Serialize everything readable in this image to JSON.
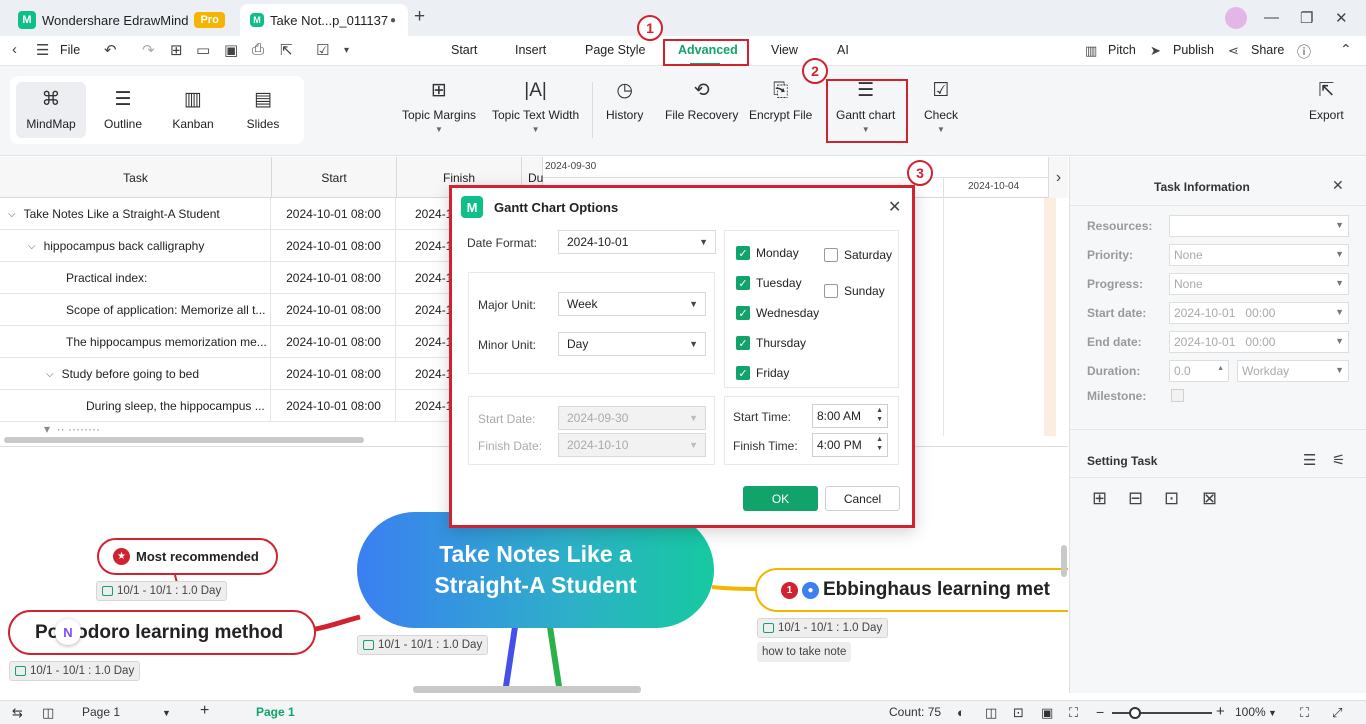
{
  "app": {
    "name": "Wondershare EdrawMind",
    "pro_badge": "Pro",
    "doc_tab": "Take Not...p_011137"
  },
  "menubar": {
    "file": "File",
    "tabs": [
      "Start",
      "Insert",
      "Page Style",
      "Advanced",
      "View",
      "AI"
    ],
    "pitch": "Pitch",
    "publish": "Publish",
    "share": "Share"
  },
  "ribbon": {
    "views": [
      "MindMap",
      "Outline",
      "Kanban",
      "Slides"
    ],
    "tools": [
      "Topic Margins",
      "Topic Text Width",
      "History",
      "File Recovery",
      "Encrypt File",
      "Gantt chart",
      "Check"
    ],
    "export": "Export"
  },
  "annotations": [
    "1",
    "2",
    "3"
  ],
  "gantt": {
    "headers": {
      "task": "Task",
      "start": "Start",
      "finish": "Finish",
      "dur": "Du"
    },
    "timeline_dates": [
      "2024-09-30",
      "2024-10-04"
    ],
    "rows": [
      {
        "task": "Take Notes Like a Straight-A Student",
        "start": "2024-10-01 08:00",
        "finish": "2024-1",
        "level": 0,
        "toggle": true
      },
      {
        "task": "hippocampus back calligraphy",
        "start": "2024-10-01 08:00",
        "finish": "2024-1",
        "level": 1,
        "toggle": true
      },
      {
        "task": "Practical index:",
        "start": "2024-10-01 08:00",
        "finish": "2024-1",
        "level": 2,
        "toggle": false
      },
      {
        "task": "Scope of application: Memorize all t...",
        "start": "2024-10-01 08:00",
        "finish": "2024-1",
        "level": 2,
        "toggle": false
      },
      {
        "task": "The hippocampus memorization me...",
        "start": "2024-10-01 08:00",
        "finish": "2024-1",
        "level": 2,
        "toggle": false
      },
      {
        "task": "Study before going to bed",
        "start": "2024-10-01 08:00",
        "finish": "2024-1",
        "level": 2,
        "toggle": true
      },
      {
        "task": "During sleep, the hippocampus ...",
        "start": "2024-10-01 08:00",
        "finish": "2024-1",
        "level": 3,
        "toggle": false
      }
    ]
  },
  "dialog": {
    "title": "Gantt Chart Options",
    "date_format_label": "Date Format:",
    "date_format_value": "2024-10-01",
    "major_unit_label": "Major Unit:",
    "major_unit_value": "Week",
    "minor_unit_label": "Minor Unit:",
    "minor_unit_value": "Day",
    "start_date_label": "Start Date:",
    "start_date_value": "2024-09-30",
    "finish_date_label": "Finish Date:",
    "finish_date_value": "2024-10-10",
    "days": [
      {
        "name": "Monday",
        "checked": true
      },
      {
        "name": "Tuesday",
        "checked": true
      },
      {
        "name": "Wednesday",
        "checked": true
      },
      {
        "name": "Thursday",
        "checked": true
      },
      {
        "name": "Friday",
        "checked": true
      },
      {
        "name": "Saturday",
        "checked": false
      },
      {
        "name": "Sunday",
        "checked": false
      }
    ],
    "start_time_label": "Start Time:",
    "start_time_value": "8:00 AM",
    "finish_time_label": "Finish Time:",
    "finish_time_value": "4:00 PM",
    "ok": "OK",
    "cancel": "Cancel"
  },
  "task_panel": {
    "title": "Task Information",
    "resources_label": "Resources:",
    "priority_label": "Priority:",
    "priority_value": "None",
    "progress_label": "Progress:",
    "progress_value": "None",
    "start_label": "Start date:",
    "start_date": "2024-10-01",
    "start_time": "00:00",
    "end_label": "End date:",
    "end_date": "2024-10-01",
    "end_time": "00:00",
    "duration_label": "Duration:",
    "duration_value": "0.0",
    "duration_unit": "Workday",
    "milestone_label": "Milestone:",
    "setting_title": "Setting Task"
  },
  "canvas": {
    "central": "Take Notes Like a Straight-A Student",
    "central_line1": "Take Notes Like a",
    "central_line2": "Straight-A Student",
    "recommended": "Most recommended",
    "pomodoro": "Pomodoro learning method",
    "ebbinghaus": "Ebbinghaus learning met",
    "chip": "10/1 - 10/1 : 1.0 Day",
    "note": "how to take note"
  },
  "status": {
    "page_select": "Page 1",
    "page_tab": "Page 1",
    "count": "Count: 75",
    "zoom": "100%"
  },
  "colors": {
    "accent": "#11a36a",
    "annotation_red": "#d0232f",
    "pomodoro_border": "#d0232f",
    "ebbinghaus_border": "#f1b600"
  }
}
